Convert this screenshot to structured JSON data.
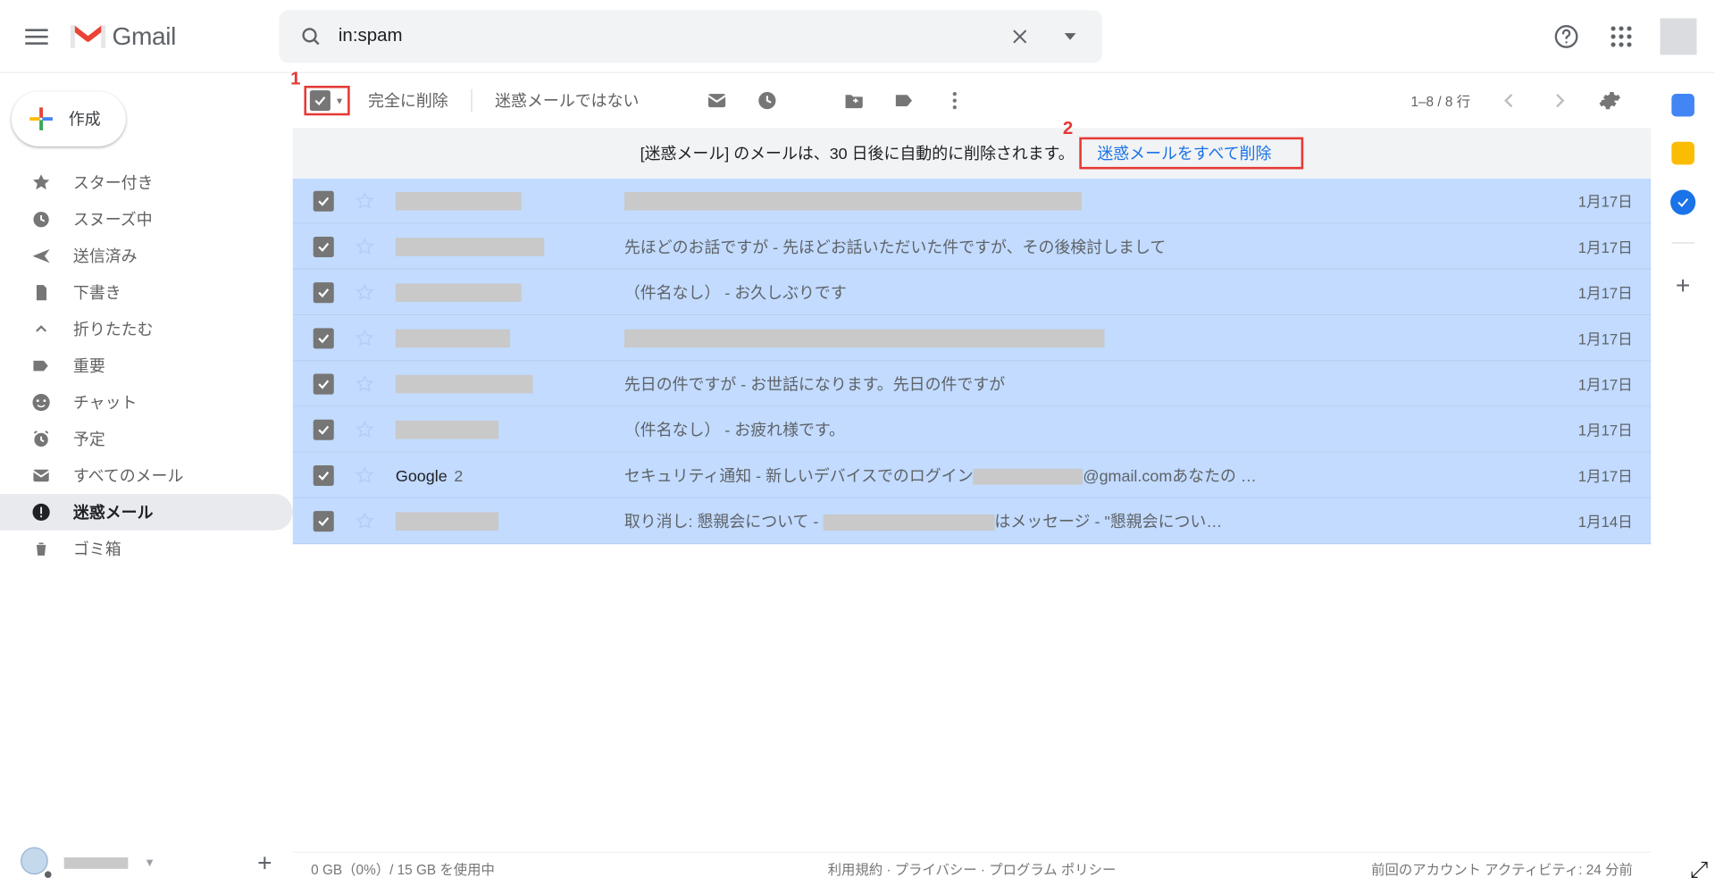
{
  "header": {
    "product": "Gmail",
    "search_value": "in:spam"
  },
  "compose_label": "作成",
  "sidebar": {
    "items": [
      {
        "label": "スター付き"
      },
      {
        "label": "スヌーズ中"
      },
      {
        "label": "送信済み"
      },
      {
        "label": "下書き"
      },
      {
        "label": "折りたたむ"
      },
      {
        "label": "重要"
      },
      {
        "label": "チャット"
      },
      {
        "label": "予定"
      },
      {
        "label": "すべてのメール"
      },
      {
        "label": "迷惑メール"
      },
      {
        "label": "ゴミ箱"
      }
    ]
  },
  "toolbar": {
    "delete_forever": "完全に削除",
    "not_spam": "迷惑メールではない",
    "count_label": "1–8 / 8 行"
  },
  "banner": {
    "text": "[迷惑メール] のメールは、30 日後に自動的に削除されます。",
    "link": "迷惑メールをすべて削除"
  },
  "annotations": {
    "one": "1",
    "two": "2"
  },
  "rows": [
    {
      "sender_ph_w": "w110",
      "subject_mode": "ph",
      "subj_ph_w": "w400",
      "date": "1月17日"
    },
    {
      "sender_ph_w": "w130",
      "subject_mode": "txt",
      "subject": "先ほどのお話ですが - 先ほどお話いただいた件ですが、その後検討しまして",
      "date": "1月17日"
    },
    {
      "sender_ph_w": "w110",
      "subject_mode": "txt",
      "subject": "（件名なし） - お久しぶりです",
      "date": "1月17日"
    },
    {
      "sender_ph_w": "w100",
      "subject_mode": "ph",
      "subj_ph_w": "w420",
      "date": "1月17日"
    },
    {
      "sender_ph_w": "w120",
      "subject_mode": "txt",
      "subject": "先日の件ですが - お世話になります。先日の件ですが",
      "date": "1月17日"
    },
    {
      "sender_ph_w": "w90",
      "subject_mode": "txt",
      "subject": "（件名なし） - お疲れ様です。",
      "date": "1月17日"
    },
    {
      "sender_text": "Google",
      "sender_count": "2",
      "subject_mode": "mix",
      "subj_pre": "セキュリティ通知 - 新しいデバイスでのログイン",
      "subj_mid_ph_w": 96,
      "subj_post": "@gmail.comあなたの …",
      "date": "1月17日"
    },
    {
      "sender_ph_w": "w90",
      "subject_mode": "mix",
      "subj_pre": "取り消し: 懇親会について - ",
      "subj_mid_ph_w": 150,
      "subj_post": "はメッセージ - \"懇親会につい…",
      "date": "1月14日"
    }
  ],
  "footer": {
    "storage": "0 GB（0%）/ 15 GB を使用中",
    "policies": "利用規約 · プライバシー · プログラム ポリシー",
    "activity": "前回のアカウント アクティビティ: 24 分前"
  }
}
